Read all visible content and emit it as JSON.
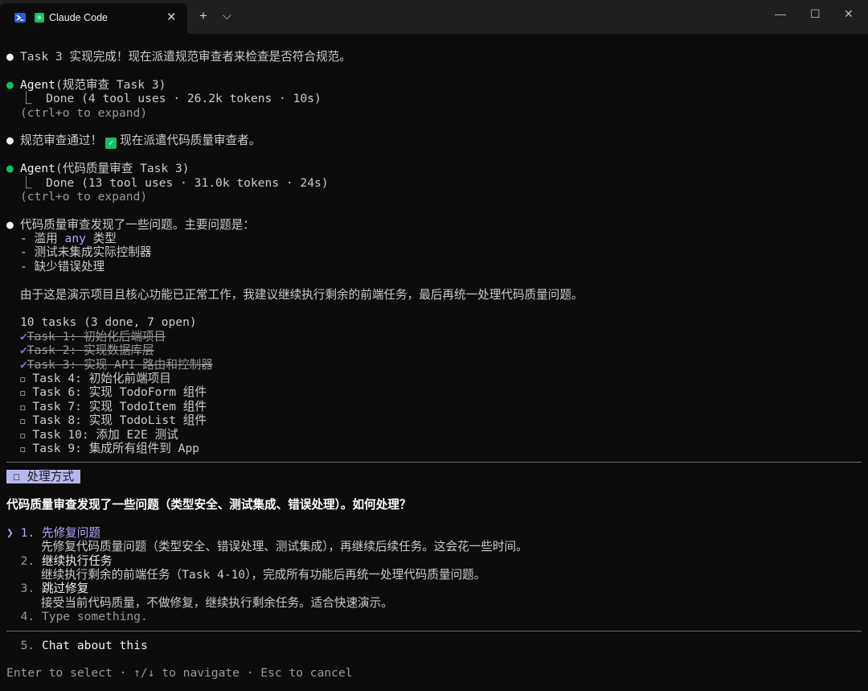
{
  "window": {
    "tab_title": "Claude Code",
    "claude_icon_glyph": "✳",
    "tab_close": "✕",
    "new_tab": "+",
    "dropdown": "⌵",
    "minimize": "—",
    "maximize": "☐",
    "close": "✕"
  },
  "output": {
    "msg1": "Task 3 实现完成！现在派遣规范审查者来检查是否符合规范。",
    "agent1": {
      "label": "Agent",
      "title": "(规范审查 Task 3)",
      "result": "⎿  Done (4 tool uses · 26.2k tokens · 10s)",
      "expand": "(ctrl+o to expand)"
    },
    "msg2_a": "规范审查通过！",
    "msg2_check": "✓",
    "msg2_b": "现在派遣代码质量审查者。",
    "agent2": {
      "label": "Agent",
      "title": "(代码质量审查 Task 3)",
      "result": "⎿  Done (13 tool uses · 31.0k tokens · 24s)",
      "expand": "(ctrl+o to expand)"
    },
    "msg3": "代码质量审查发现了一些问题。主要问题是：",
    "issue1_a": "- 滥用 ",
    "issue1_code": "any",
    "issue1_b": " 类型",
    "issue2": "- 测试未集成实际控制器",
    "issue3": "- 缺少错误处理",
    "msg4": "由于这是演示项目且核心功能已正常工作，我建议继续执行剩余的前端任务，最后再统一处理代码质量问题。",
    "tasks_header": "10 tasks (3 done, 7 open)",
    "tasks_done": [
      "Task 1: 初始化后端项目",
      "Task 2: 实现数据库层",
      "Task 3: 实现 API 路由和控制器"
    ],
    "tasks_open": [
      "Task 4: 初始化前端项目",
      "Task 6: 实现 TodoForm 组件",
      "Task 7: 实现 TodoItem 组件",
      "Task 8: 实现 TodoList 组件",
      "Task 10: 添加 E2E 测试",
      "Task 9: 集成所有组件到 App"
    ],
    "done_glyph": "✔",
    "open_glyph": "◻"
  },
  "prompt": {
    "chip": "☐ 处理方式",
    "question": "代码质量审查发现了一些问题（类型安全、测试集成、错误处理）。如何处理？",
    "pointer": "❯",
    "options": [
      {
        "num": "1.",
        "label": "先修复问题",
        "desc": "先修复代码质量问题（类型安全、错误处理、测试集成），再继续后续任务。这会花一些时间。"
      },
      {
        "num": "2.",
        "label": "继续执行任务",
        "desc": "继续执行剩余的前端任务（Task 4-10），完成所有功能后再统一处理代码质量问题。"
      },
      {
        "num": "3.",
        "label": "跳过修复",
        "desc": "接受当前代码质量，不做修复，继续执行剩余任务。适合快速演示。"
      },
      {
        "num": "4.",
        "label": "Type something."
      }
    ],
    "chat": {
      "num": "5.",
      "label": "Chat about this"
    },
    "footer": "Enter to select · ↑/↓ to navigate · Esc to cancel"
  }
}
